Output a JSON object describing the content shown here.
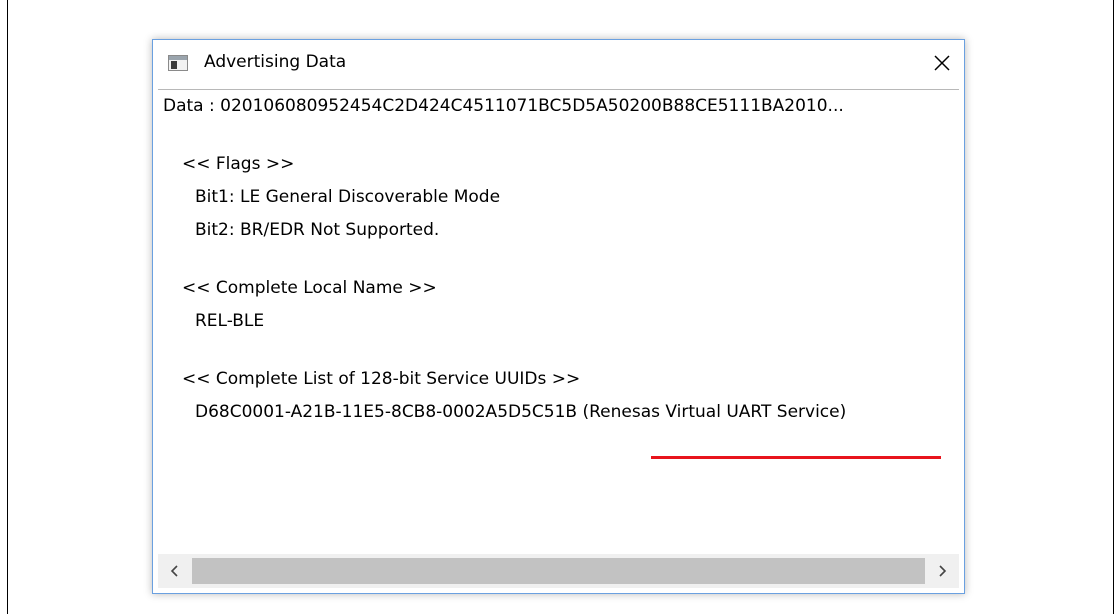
{
  "window": {
    "title": "Advertising Data",
    "icon": "app-window-icon",
    "close_icon": "close-icon"
  },
  "content": {
    "data_line": "Data : 020106080952454C2D424C4511071BC5D5A50200B88CE5111BA2010...",
    "flags_header": "<< Flags >>",
    "flag_bit1": "Bit1: LE General Discoverable Mode",
    "flag_bit2": "Bit2: BR/EDR Not Supported.",
    "local_name_header": "<< Complete Local Name >>",
    "local_name_value": "REL-BLE",
    "uuid_header": "<< Complete List of 128-bit Service UUIDs >>",
    "uuid_value": "D68C0001-A21B-11E5-8CB8-0002A5D5C51B (Renesas Virtual UART Service)",
    "highlight_color": "#e8141c"
  },
  "scrollbar": {
    "left_icon": "chevron-left-icon",
    "right_icon": "chevron-right-icon"
  }
}
